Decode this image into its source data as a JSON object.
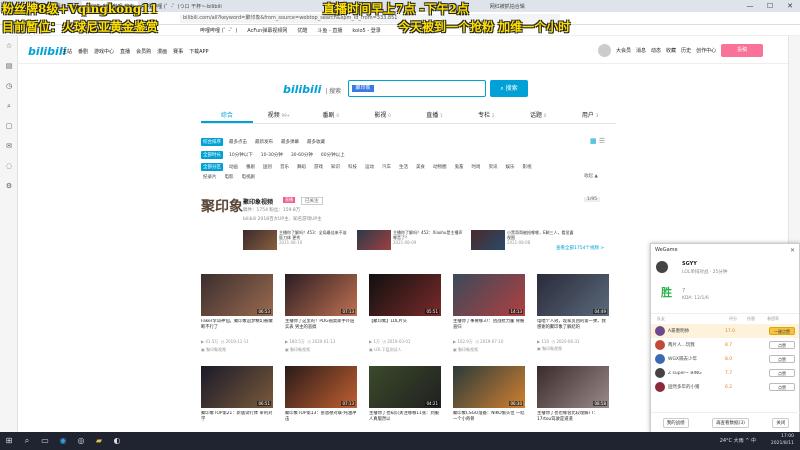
{
  "browser": {
    "tabs": [
      {
        "label": "王朗 - 搜索结果 哔哩哔哩_Bilibili",
        "active": false
      },
      {
        "label": "聚印象 哔哩哔哩 搜索",
        "active": true
      },
      {
        "label": "哔哩哔哩 (゜-゜)つロ 干杯~-bilibili",
        "active": false
      },
      {
        "label": "网红被抓拍合辑",
        "active": false
      }
    ],
    "address": "bilibili.com/all?keyword=聚印象&from_source=webtop_search&spm_id_from=333.851",
    "bookmarks": [
      "哔哩哔哩 (゜-゜)",
      "AcFun弹幕视频网",
      "优酷",
      "斗鱼 - 直播",
      "kolo5 - 登录"
    ],
    "window_controls": [
      "—",
      "☐",
      "✕"
    ]
  },
  "overlays": {
    "line1": "粉丝牌8级+Vqingkong11",
    "line2": "目前暂位：火球尼亚黄金鉴赏",
    "line3": "直播时间早上7点 -下午2点",
    "line4": "今天被到一个抢粉 加维一个小时"
  },
  "bili": {
    "logo": "bilibili",
    "nav": [
      "主站",
      "番剧",
      "游戏中心",
      "直播",
      "会员购",
      "漫画",
      "赛事",
      "下载APP"
    ],
    "user": [
      "大会员",
      "消息",
      "动态",
      "收藏",
      "历史",
      "创作中心"
    ],
    "post": "投稿",
    "search_logo": "bilibili",
    "search_logo_suffix": "| 搜索",
    "search_value": "聚印象",
    "search_button": "搜索"
  },
  "tabs": [
    {
      "label": "综合",
      "count": ""
    },
    {
      "label": "视频",
      "count": "99+"
    },
    {
      "label": "番剧",
      "count": "0"
    },
    {
      "label": "影视",
      "count": "0"
    },
    {
      "label": "直播",
      "count": "1"
    },
    {
      "label": "专栏",
      "count": "2"
    },
    {
      "label": "话题",
      "count": "0"
    },
    {
      "label": "用户",
      "count": "3"
    }
  ],
  "filters": {
    "sort": [
      "综合排序",
      "最多点击",
      "最新发布",
      "最多弹幕",
      "最多收藏"
    ],
    "duration": [
      "全部时长",
      "10分钟以下",
      "10-30分钟",
      "30-60分钟",
      "60分钟以上"
    ],
    "zones1": [
      "全部分区",
      "动画",
      "番剧",
      "国创",
      "音乐",
      "舞蹈",
      "游戏",
      "知识",
      "科技",
      "运动",
      "汽车",
      "生活",
      "美食",
      "动物圈",
      "鬼畜",
      "时尚",
      "资讯",
      "娱乐",
      "影视"
    ],
    "zones2": [
      "纪录片",
      "电影",
      "电视剧"
    ],
    "collapse": "收起 ▲"
  },
  "upcard": {
    "logo": "聚印象",
    "name": "聚印象视频",
    "live": "直播",
    "follow": "已关注",
    "stats": "稿件：1754   粉丝：159.8万",
    "desc": "bilibili 2018百大UP主、知名游戏UP主",
    "pager": "1/95",
    "mini": [
      {
        "title": "主播你了解吗？453：全局最佳来不该医刀体 更秀",
        "date": "2021-08-10"
      },
      {
        "title": "主播你了解吗？452：Xiaohu是主播声哪音了？",
        "date": "2021-08-09"
      },
      {
        "title": "小黑哥哥被抢哪哪，E剩三人，看显露视图",
        "date": "2021-08-08"
      }
    ],
    "more": "查看全部1754个视频 >"
  },
  "videos": [
    {
      "dur": "06:53",
      "title": "Faker李哥神仙，聚印象追梦精幻被嫩断不行了",
      "views": "41.5万",
      "date": "2019-11-11",
      "up": "聚印象视频"
    },
    {
      "dur": "07:13",
      "title": "主播你了这里的！PDG丽莫斯手吓层实表 男主的恶搞",
      "views": "180.5万",
      "date": "2020-01-13",
      "up": "聚印象视频"
    },
    {
      "dur": "05:51",
      "title": "【聚印象】LOL片头",
      "views": "1万",
      "date": "2019-03-01",
      "up": "LOL下层测试人"
    },
    {
      "dur": "14:13",
      "title": "主播你了事要哪37：团战抗力量 骨骼直归",
      "views": "102.9万",
      "date": "2019-07-10",
      "up": "聚印象视频"
    },
    {
      "dur": "04:49",
      "title": "电唱个人效，现家贯团的第一弹，我感谢的聚印象了解结的",
      "views": "110",
      "date": "2020-06-31",
      "up": "聚印象视频"
    },
    {
      "dur": "06:51",
      "title": "聚印象TOP第21：新版试行体 审利对学",
      "views": "",
      "date": "",
      "up": ""
    },
    {
      "dur": "07:13",
      "title": "聚印象TOP第13：张恩德对联·纯油冲击",
      "views": "",
      "date": "",
      "up": ""
    },
    {
      "dur": "04:21",
      "title": "主播你了也知识关注哪哪11张：到服人真版然以",
      "views": "",
      "date": "",
      "up": ""
    },
    {
      "dur": "06:30",
      "title": "聚印象CSGO准备：NIKO偷头位 一结一个小奇骨",
      "views": "",
      "date": "",
      "up": ""
    },
    {
      "dur": "08:58",
      "title": "主播你了也也哪会比较理解TT：17rtou驾驶是道道",
      "views": "",
      "date": "",
      "up": ""
    }
  ],
  "wegame": {
    "title": "WeGame",
    "close": "✕",
    "player": "SGYY",
    "mode": "LOL单排对战 · 25分钟",
    "result": "胜",
    "kda_score": "7",
    "kda": "KDA: 12/1/6",
    "columns": [
      "队友",
      "评分",
      "伤害",
      "参团率"
    ],
    "players": [
      {
        "name": "A豪墨明帅",
        "score": "17.0",
        "btn": "一键点赞",
        "hl": true,
        "color": "#6a4a8a"
      },
      {
        "name": "两片人...玩我",
        "score": "8.7",
        "btn": "点赞",
        "hl": false,
        "color": "#c24a3a"
      },
      {
        "name": "WGX隔去少年",
        "score": "8.0",
        "btn": "点赞",
        "hl": false,
        "color": "#3a6ab2"
      },
      {
        "name": "Z super~ BING",
        "score": "7.7",
        "btn": "点赞",
        "hl": false,
        "color": "#444"
      },
      {
        "name": "固然多年的小猪",
        "score": "6.2",
        "btn": "点赞",
        "hl": false,
        "color": "#8a2a3a"
      }
    ],
    "footer": [
      "我的战绩",
      "再查看数据(3)",
      "关闭"
    ]
  },
  "taskbar": {
    "tray": "24°C 大雨  ^  中",
    "time": "17:00",
    "date": "2021/8/11"
  }
}
